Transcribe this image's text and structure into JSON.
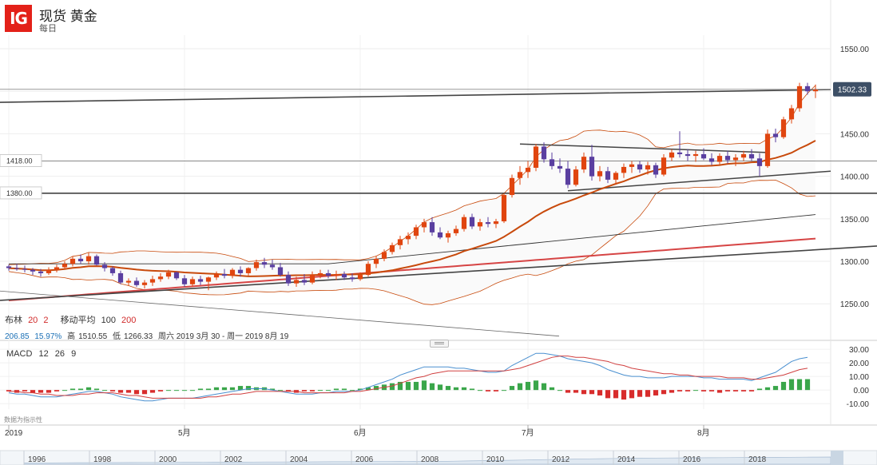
{
  "header": {
    "logo": "IG",
    "title": "现货 黄金",
    "subtitle": "每日"
  },
  "indicators": {
    "bollinger_label": "布林",
    "bollinger_period": "20",
    "bollinger_dev": "2",
    "ma_label": "移动平均",
    "ma_fast": "100",
    "ma_slow": "200"
  },
  "stats": {
    "v1": "206.85",
    "v2": "15.97%",
    "high_label": "高",
    "high": "1510.55",
    "low_label": "低",
    "low": "1266.33",
    "range": "周六 2019 3月 30 - 周一 2019 8月 19"
  },
  "macd": {
    "label": "MACD",
    "fast": "12",
    "slow": "26",
    "signal": "9"
  },
  "disclaimer": "数据为指示性",
  "colors": {
    "up": "#e0450f",
    "down": "#5a3fa0",
    "ma20": "#c84a0c",
    "ma200": "#d64545",
    "trend": "#444444",
    "macd_pos": "#3aa64a",
    "macd_neg": "#d82c2c",
    "macd_line": "#4a90d0",
    "signal_line": "#d04040",
    "brand": "#e32119",
    "price_label_bg": "#3d4f66"
  },
  "chart_data": {
    "type": "candlestick",
    "price_axis": {
      "ticks": [
        1250,
        1300,
        1350,
        1400,
        1450,
        1500,
        1550
      ],
      "tick_labels": [
        "1250.00",
        "1300.00",
        "1350.00",
        "1400.00",
        "1450.00",
        "",
        "1550.00"
      ],
      "range": [
        1207,
        1566
      ]
    },
    "time_axis": {
      "labels": [
        "2019",
        "5月",
        "6月",
        "7月",
        "8月"
      ],
      "label_index": [
        0,
        22,
        44,
        65,
        87
      ]
    },
    "last_price": "1502.33",
    "horizontal_levels": [
      {
        "value": 1418,
        "label": "1418.00"
      },
      {
        "value": 1380,
        "label": "1380.00"
      }
    ],
    "candles": [
      [
        1294,
        1296,
        1289,
        1292
      ],
      [
        1292,
        1297,
        1289,
        1291
      ],
      [
        1291,
        1295,
        1287,
        1290
      ],
      [
        1290,
        1292,
        1284,
        1288
      ],
      [
        1288,
        1291,
        1282,
        1286
      ],
      [
        1286,
        1293,
        1284,
        1290
      ],
      [
        1290,
        1296,
        1287,
        1293
      ],
      [
        1293,
        1300,
        1291,
        1297
      ],
      [
        1297,
        1306,
        1294,
        1303
      ],
      [
        1303,
        1308,
        1297,
        1300
      ],
      [
        1300,
        1310,
        1296,
        1306
      ],
      [
        1306,
        1308,
        1295,
        1296
      ],
      [
        1296,
        1299,
        1288,
        1292
      ],
      [
        1292,
        1294,
        1283,
        1286
      ],
      [
        1286,
        1289,
        1273,
        1275
      ],
      [
        1275,
        1280,
        1271,
        1277
      ],
      [
        1277,
        1281,
        1270,
        1272
      ],
      [
        1272,
        1278,
        1268,
        1275
      ],
      [
        1275,
        1283,
        1271,
        1279
      ],
      [
        1279,
        1286,
        1276,
        1282
      ],
      [
        1282,
        1290,
        1279,
        1287
      ],
      [
        1287,
        1288,
        1278,
        1280
      ],
      [
        1280,
        1284,
        1270,
        1273
      ],
      [
        1273,
        1282,
        1270,
        1279
      ],
      [
        1279,
        1283,
        1272,
        1276
      ],
      [
        1276,
        1282,
        1266,
        1281
      ],
      [
        1281,
        1288,
        1278,
        1285
      ],
      [
        1285,
        1291,
        1280,
        1283
      ],
      [
        1283,
        1292,
        1280,
        1290
      ],
      [
        1290,
        1294,
        1282,
        1286
      ],
      [
        1286,
        1293,
        1283,
        1292
      ],
      [
        1292,
        1302,
        1289,
        1299
      ],
      [
        1299,
        1304,
        1292,
        1296
      ],
      [
        1296,
        1302,
        1290,
        1293
      ],
      [
        1293,
        1298,
        1282,
        1284
      ],
      [
        1284,
        1288,
        1271,
        1274
      ],
      [
        1274,
        1282,
        1270,
        1278
      ],
      [
        1278,
        1285,
        1272,
        1275
      ],
      [
        1275,
        1288,
        1273,
        1284
      ],
      [
        1284,
        1290,
        1280,
        1286
      ],
      [
        1286,
        1290,
        1280,
        1283
      ],
      [
        1283,
        1289,
        1278,
        1285
      ],
      [
        1285,
        1288,
        1278,
        1281
      ],
      [
        1281,
        1286,
        1276,
        1279
      ],
      [
        1279,
        1287,
        1277,
        1284
      ],
      [
        1284,
        1300,
        1282,
        1297
      ],
      [
        1297,
        1306,
        1292,
        1303
      ],
      [
        1303,
        1314,
        1300,
        1311
      ],
      [
        1311,
        1322,
        1308,
        1319
      ],
      [
        1319,
        1330,
        1314,
        1326
      ],
      [
        1326,
        1334,
        1320,
        1330
      ],
      [
        1330,
        1343,
        1326,
        1340
      ],
      [
        1340,
        1350,
        1334,
        1346
      ],
      [
        1346,
        1352,
        1330,
        1334
      ],
      [
        1334,
        1340,
        1326,
        1328
      ],
      [
        1328,
        1336,
        1322,
        1333
      ],
      [
        1333,
        1342,
        1330,
        1338
      ],
      [
        1338,
        1355,
        1335,
        1352
      ],
      [
        1352,
        1356,
        1338,
        1341
      ],
      [
        1341,
        1350,
        1336,
        1346
      ],
      [
        1346,
        1352,
        1340,
        1344
      ],
      [
        1344,
        1350,
        1339,
        1347
      ],
      [
        1347,
        1380,
        1345,
        1378
      ],
      [
        1378,
        1402,
        1375,
        1398
      ],
      [
        1398,
        1412,
        1390,
        1405
      ],
      [
        1405,
        1418,
        1398,
        1410
      ],
      [
        1410,
        1438,
        1406,
        1435
      ],
      [
        1435,
        1440,
        1416,
        1420
      ],
      [
        1420,
        1428,
        1408,
        1412
      ],
      [
        1412,
        1421,
        1404,
        1409
      ],
      [
        1409,
        1418,
        1386,
        1390
      ],
      [
        1390,
        1412,
        1388,
        1408
      ],
      [
        1408,
        1428,
        1404,
        1423
      ],
      [
        1423,
        1437,
        1395,
        1400
      ],
      [
        1400,
        1412,
        1394,
        1406
      ],
      [
        1406,
        1411,
        1392,
        1396
      ],
      [
        1396,
        1406,
        1390,
        1404
      ],
      [
        1404,
        1415,
        1398,
        1411
      ],
      [
        1411,
        1418,
        1404,
        1414
      ],
      [
        1414,
        1418,
        1404,
        1408
      ],
      [
        1408,
        1417,
        1402,
        1413
      ],
      [
        1413,
        1416,
        1398,
        1402
      ],
      [
        1402,
        1426,
        1400,
        1422
      ],
      [
        1422,
        1432,
        1418,
        1428
      ],
      [
        1428,
        1453,
        1422,
        1426
      ],
      [
        1426,
        1432,
        1418,
        1424
      ],
      [
        1424,
        1430,
        1417,
        1426
      ],
      [
        1426,
        1433,
        1419,
        1421
      ],
      [
        1421,
        1427,
        1413,
        1417
      ],
      [
        1417,
        1427,
        1414,
        1424
      ],
      [
        1424,
        1430,
        1415,
        1419
      ],
      [
        1419,
        1426,
        1412,
        1422
      ],
      [
        1422,
        1430,
        1418,
        1426
      ],
      [
        1426,
        1432,
        1418,
        1421
      ],
      [
        1421,
        1427,
        1400,
        1412
      ],
      [
        1412,
        1455,
        1410,
        1450
      ],
      [
        1450,
        1456,
        1440,
        1446
      ],
      [
        1446,
        1470,
        1444,
        1467
      ],
      [
        1467,
        1484,
        1462,
        1480
      ],
      [
        1480,
        1510,
        1476,
        1506
      ],
      [
        1506,
        1510,
        1496,
        1500
      ],
      [
        1500,
        1508,
        1492,
        1502
      ]
    ],
    "series": [
      {
        "name": "MACD",
        "values": [
          -2,
          -3,
          -3,
          -4,
          -5,
          -5,
          -5,
          -4,
          -3,
          -2,
          -1,
          -1,
          -2,
          -3,
          -5,
          -6,
          -7,
          -8,
          -8,
          -7,
          -6,
          -6,
          -6,
          -6,
          -5,
          -4,
          -3,
          -2,
          -1,
          0,
          1,
          1,
          1,
          0,
          -1,
          -2,
          -3,
          -3,
          -3,
          -2,
          -2,
          -1,
          -1,
          -1,
          0,
          2,
          4,
          6,
          8,
          11,
          13,
          15,
          17,
          17,
          17,
          17,
          16,
          16,
          15,
          14,
          13,
          13,
          14,
          18,
          21,
          24,
          27,
          27,
          26,
          25,
          23,
          22,
          21,
          20,
          18,
          15,
          13,
          11,
          10,
          10,
          9,
          9,
          9,
          10,
          10,
          10,
          10,
          9,
          9,
          8,
          8,
          8,
          8,
          7,
          9,
          11,
          13,
          17,
          21,
          23,
          24
        ]
      },
      {
        "name": "Signal",
        "values": [
          -1,
          -1,
          -2,
          -2,
          -3,
          -3,
          -4,
          -4,
          -4,
          -3,
          -3,
          -2,
          -2,
          -2,
          -3,
          -4,
          -4,
          -5,
          -6,
          -6,
          -6,
          -6,
          -6,
          -6,
          -6,
          -5,
          -5,
          -4,
          -3,
          -3,
          -2,
          -1,
          -1,
          -1,
          -1,
          -1,
          -1,
          -2,
          -2,
          -2,
          -2,
          -2,
          -2,
          -1,
          -1,
          0,
          1,
          2,
          3,
          5,
          7,
          9,
          10,
          12,
          13,
          14,
          14,
          14,
          14,
          14,
          14,
          14,
          14,
          15,
          16,
          18,
          20,
          22,
          24,
          25,
          25,
          24,
          24,
          23,
          22,
          21,
          19,
          18,
          16,
          15,
          14,
          13,
          12,
          12,
          11,
          11,
          10,
          10,
          10,
          10,
          9,
          9,
          9,
          8,
          8,
          9,
          10,
          11,
          13,
          15,
          16
        ]
      },
      {
        "name": "Histogram",
        "values": [
          -1,
          -2,
          -1,
          -2,
          -2,
          -2,
          -1,
          0,
          1,
          1,
          2,
          1,
          0,
          -1,
          -2,
          -2,
          -3,
          -3,
          -2,
          -1,
          0,
          0,
          0,
          0,
          1,
          1,
          2,
          2,
          2,
          3,
          3,
          2,
          2,
          1,
          0,
          -1,
          -2,
          -1,
          -1,
          0,
          0,
          1,
          1,
          0,
          1,
          2,
          3,
          4,
          5,
          6,
          6,
          6,
          7,
          5,
          4,
          3,
          2,
          2,
          1,
          0,
          -1,
          -1,
          0,
          3,
          5,
          6,
          7,
          5,
          2,
          0,
          -2,
          -2,
          -3,
          -3,
          -4,
          -6,
          -6,
          -7,
          -6,
          -5,
          -5,
          -4,
          -3,
          -2,
          -1,
          -1,
          0,
          -1,
          -1,
          -2,
          -1,
          -1,
          -1,
          -1,
          1,
          2,
          3,
          6,
          8,
          8,
          8
        ]
      }
    ],
    "macd_axis": {
      "ticks": [
        30,
        20,
        10,
        0,
        -10
      ],
      "tick_labels": [
        "30.00",
        "20.00",
        "10.00",
        "0.00",
        "-10.00"
      ],
      "range": [
        -14,
        33
      ]
    },
    "navigator": {
      "labels": [
        "1996",
        "1998",
        "2000",
        "2002",
        "2004",
        "2006",
        "2008",
        "2010",
        "2012",
        "2014",
        "2016",
        "2018"
      ]
    }
  }
}
